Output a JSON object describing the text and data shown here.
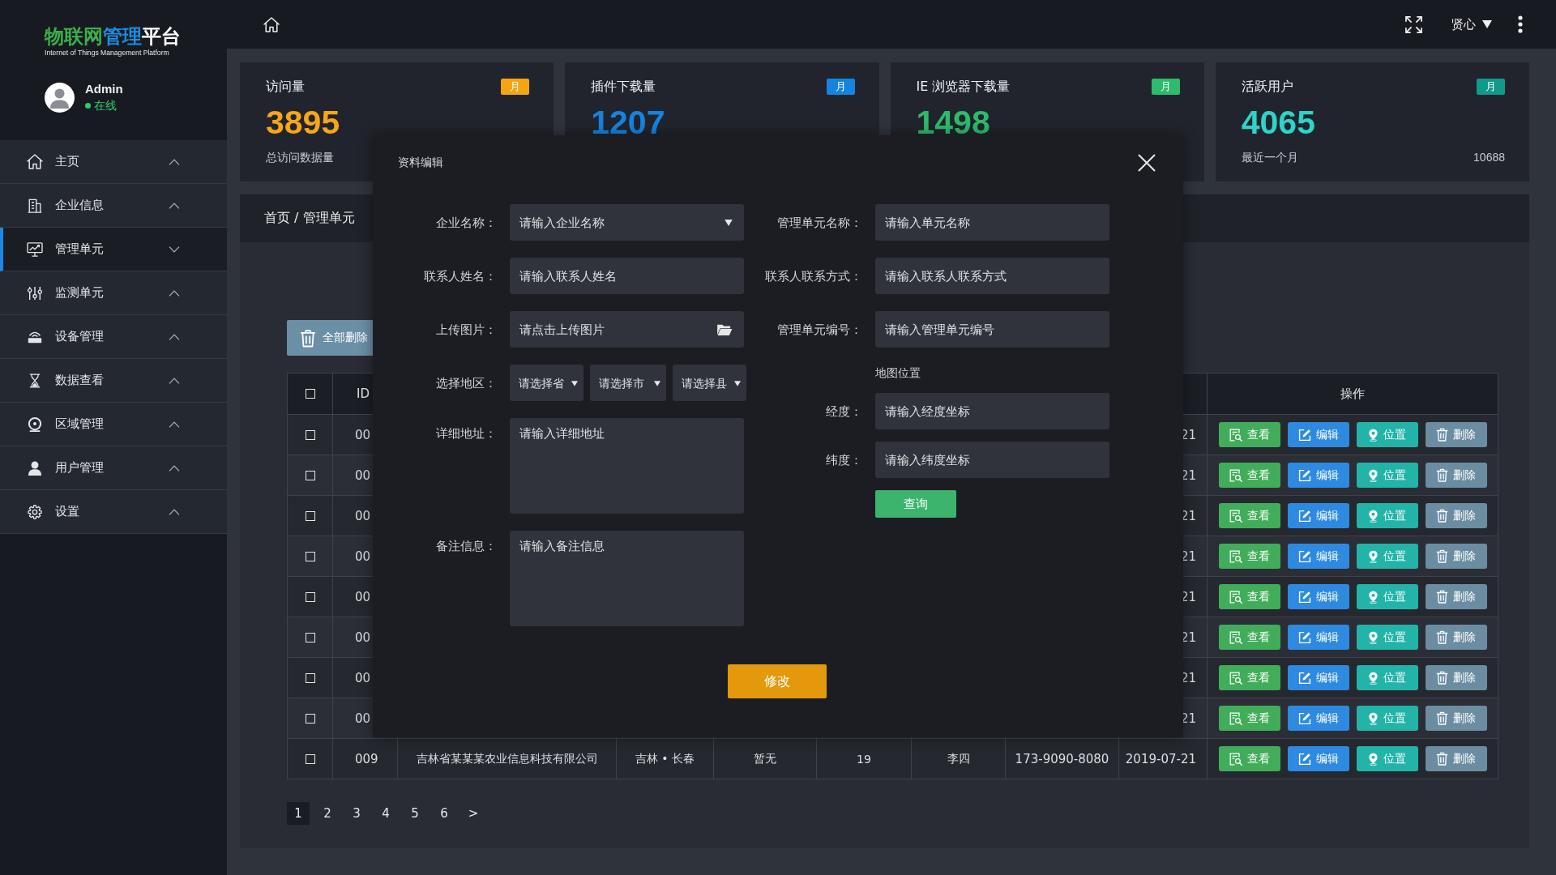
{
  "sidebar": {
    "logo": {
      "title_parts": [
        "物联网",
        "管理",
        "平台"
      ],
      "subtitle": "Internet of Things Management Platform"
    },
    "user": {
      "name": "Admin",
      "status": "在线",
      "online": true
    },
    "items": [
      {
        "label": "主页",
        "selected": false,
        "expanded": false
      },
      {
        "label": "企业信息",
        "selected": false,
        "expanded": false
      },
      {
        "label": "管理单元",
        "selected": true,
        "expanded": true
      },
      {
        "label": "监测单元",
        "selected": false,
        "expanded": false
      },
      {
        "label": "设备管理",
        "selected": false,
        "expanded": false
      },
      {
        "label": "数据查看",
        "selected": false,
        "expanded": false
      },
      {
        "label": "区域管理",
        "selected": false,
        "expanded": false
      },
      {
        "label": "用户管理",
        "selected": false,
        "expanded": false
      },
      {
        "label": "设置",
        "selected": false,
        "expanded": false
      }
    ]
  },
  "header": {
    "user_menu": "贤心"
  },
  "stats": [
    {
      "title": "访问量",
      "badge": {
        "text": "月",
        "color": "#f5a512"
      },
      "value": "3895",
      "color": "#f7a618",
      "caption": "总访问数据量"
    },
    {
      "title": "插件下载量",
      "badge": {
        "text": "月",
        "color": "#1584e0"
      },
      "value": "1207",
      "color": "#1584e0"
    },
    {
      "title": "IE 浏览器下载量",
      "badge": {
        "text": "月",
        "color": "#2dbb6c"
      },
      "value": "1498",
      "color": "#2dbb6c"
    },
    {
      "title": "活跃用户",
      "badge": {
        "text": "月",
        "color": "#11998b"
      },
      "value": "4065",
      "color": "#2ed3c9",
      "caption": "最近一个月",
      "total": "10688"
    }
  ],
  "breadcrumb": "首页 / 管理单元",
  "toolbar": [
    {
      "kind": "delete_all",
      "label": "全部删除"
    }
  ],
  "table": {
    "select_all": {
      "checked": false
    },
    "columns": [
      "ID",
      null,
      null,
      null,
      null,
      null,
      null,
      null,
      "操作"
    ],
    "rows": [
      {
        "checked": false,
        "cells": [
          "00",
          null,
          null,
          null,
          null,
          null,
          null,
          "21"
        ],
        "actions": [
          {
            "kind": "view",
            "label": "查看"
          },
          {
            "kind": "edit",
            "label": "编辑"
          },
          {
            "kind": "locate",
            "label": "位置"
          },
          {
            "kind": "delete",
            "label": "删除"
          }
        ]
      },
      {
        "checked": false,
        "cells": [
          "00",
          null,
          null,
          null,
          null,
          null,
          null,
          "21"
        ],
        "actions": [
          {
            "kind": "view",
            "label": "查看"
          },
          {
            "kind": "edit",
            "label": "编辑"
          },
          {
            "kind": "locate",
            "label": "位置"
          },
          {
            "kind": "delete",
            "label": "删除"
          }
        ]
      },
      {
        "checked": false,
        "cells": [
          "00",
          null,
          null,
          null,
          null,
          null,
          null,
          "21"
        ],
        "actions": [
          {
            "kind": "view",
            "label": "查看"
          },
          {
            "kind": "edit",
            "label": "编辑"
          },
          {
            "kind": "locate",
            "label": "位置"
          },
          {
            "kind": "delete",
            "label": "删除"
          }
        ]
      },
      {
        "checked": false,
        "cells": [
          "00",
          null,
          null,
          null,
          null,
          null,
          null,
          "21"
        ],
        "actions": [
          {
            "kind": "view",
            "label": "查看"
          },
          {
            "kind": "edit",
            "label": "编辑"
          },
          {
            "kind": "locate",
            "label": "位置"
          },
          {
            "kind": "delete",
            "label": "删除"
          }
        ]
      },
      {
        "checked": false,
        "cells": [
          "00",
          null,
          null,
          null,
          null,
          null,
          null,
          "21"
        ],
        "actions": [
          {
            "kind": "view",
            "label": "查看"
          },
          {
            "kind": "edit",
            "label": "编辑"
          },
          {
            "kind": "locate",
            "label": "位置"
          },
          {
            "kind": "delete",
            "label": "删除"
          }
        ]
      },
      {
        "checked": false,
        "cells": [
          "00",
          null,
          null,
          null,
          null,
          null,
          null,
          "21"
        ],
        "actions": [
          {
            "kind": "view",
            "label": "查看"
          },
          {
            "kind": "edit",
            "label": "编辑"
          },
          {
            "kind": "locate",
            "label": "位置"
          },
          {
            "kind": "delete",
            "label": "删除"
          }
        ]
      },
      {
        "checked": false,
        "cells": [
          "00",
          null,
          null,
          null,
          null,
          null,
          null,
          "21"
        ],
        "actions": [
          {
            "kind": "view",
            "label": "查看"
          },
          {
            "kind": "edit",
            "label": "编辑"
          },
          {
            "kind": "locate",
            "label": "位置"
          },
          {
            "kind": "delete",
            "label": "删除"
          }
        ]
      },
      {
        "checked": false,
        "cells": [
          "00",
          null,
          null,
          null,
          null,
          null,
          null,
          "21"
        ],
        "actions": [
          {
            "kind": "view",
            "label": "查看"
          },
          {
            "kind": "edit",
            "label": "编辑"
          },
          {
            "kind": "locate",
            "label": "位置"
          },
          {
            "kind": "delete",
            "label": "删除"
          }
        ]
      },
      {
        "checked": false,
        "cells": [
          "009",
          "吉林省某某某农业信息科技有限公司",
          "吉林 • 长春",
          "暂无",
          "19",
          "李四",
          "173-9090-8080",
          "2019-07-21"
        ],
        "actions": [
          {
            "kind": "view",
            "label": "查看"
          },
          {
            "kind": "edit",
            "label": "编辑"
          },
          {
            "kind": "locate",
            "label": "位置"
          },
          {
            "kind": "delete",
            "label": "删除"
          }
        ]
      }
    ]
  },
  "pagination": {
    "pages": [
      {
        "label": "1",
        "selected": true
      },
      {
        "label": "2",
        "selected": false
      },
      {
        "label": "3",
        "selected": false
      },
      {
        "label": "4",
        "selected": false
      },
      {
        "label": "5",
        "selected": false
      },
      {
        "label": "6",
        "selected": false
      }
    ],
    "next": ">"
  },
  "modal": {
    "title": "资料编辑",
    "left_fields": [
      {
        "kind": "select",
        "label": "企业名称：",
        "placeholder": "请输入企业名称"
      },
      {
        "kind": "text",
        "label": "联系人姓名：",
        "placeholder": "请输入联系人姓名"
      },
      {
        "kind": "upload",
        "label": "上传图片：",
        "placeholder": "请点击上传图片"
      },
      {
        "kind": "region",
        "label": "选择地区：",
        "selects": [
          {
            "placeholder": "请选择省"
          },
          {
            "placeholder": "请选择市"
          },
          {
            "placeholder": "请选择县"
          }
        ]
      },
      {
        "kind": "textarea",
        "label": "详细地址：",
        "placeholder": "请输入详细地址"
      },
      {
        "kind": "textarea",
        "label": "备注信息：",
        "placeholder": "请输入备注信息"
      }
    ],
    "right_fields": [
      {
        "kind": "text",
        "label": "管理单元名称：",
        "placeholder": "请输入单元名称"
      },
      {
        "kind": "text",
        "label": "联系人联系方式：",
        "placeholder": "请输入联系人联系方式"
      },
      {
        "kind": "text",
        "label": "管理单元编号：",
        "placeholder": "请输入管理单元编号"
      }
    ],
    "map": {
      "title": "地图位置",
      "fields": [
        {
          "kind": "text",
          "label": "经度：",
          "placeholder": "请输入经度坐标"
        },
        {
          "kind": "text",
          "label": "纬度：",
          "placeholder": "请输入纬度坐标"
        }
      ],
      "button": "查询"
    },
    "submit": "修改"
  }
}
